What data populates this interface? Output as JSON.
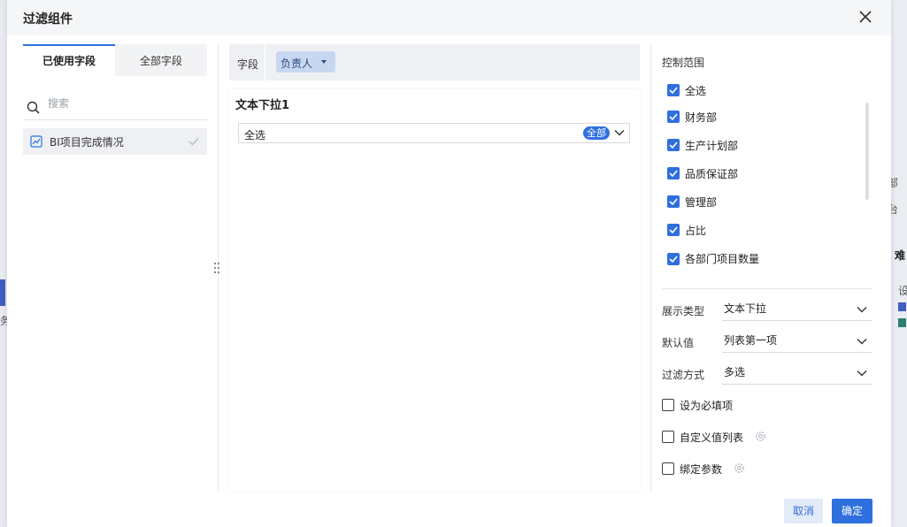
{
  "dialog": {
    "title": "过滤组件"
  },
  "left": {
    "tabs": [
      "已使用字段",
      "全部字段"
    ],
    "search_placeholder": "搜索",
    "datasets": [
      {
        "label": "BI项目完成情况"
      }
    ]
  },
  "middle": {
    "field_label": "字段",
    "field_value": "负责人",
    "preview": {
      "title": "文本下拉1",
      "select_value": "全选",
      "badge": "全部"
    }
  },
  "right": {
    "scope_title": "控制范围",
    "scope_items": [
      {
        "label": "全选",
        "checked": true
      },
      {
        "label": "财务部",
        "checked": true
      },
      {
        "label": "生产计划部",
        "checked": true
      },
      {
        "label": "品质保证部",
        "checked": true
      },
      {
        "label": "管理部",
        "checked": true
      },
      {
        "label": "占比",
        "checked": true
      },
      {
        "label": "各部门项目数量",
        "checked": true
      }
    ],
    "props": [
      {
        "label": "展示类型",
        "value": "文本下拉"
      },
      {
        "label": "默认值",
        "value": "列表第一项"
      },
      {
        "label": "过滤方式",
        "value": "多选"
      }
    ],
    "options": [
      {
        "label": "设为必填项",
        "checked": false,
        "gear": false
      },
      {
        "label": "自定义值列表",
        "checked": false,
        "gear": true
      },
      {
        "label": "绑定参数",
        "checked": false,
        "gear": true
      }
    ]
  },
  "footer": {
    "cancel": "取消",
    "ok": "确定"
  },
  "background": {
    "texts": [
      "部",
      "台",
      "难",
      "设",
      "务"
    ]
  },
  "colors": {
    "accent": "#2f6fde",
    "chip": "#c8d7f0",
    "panel": "#eef0f4"
  }
}
